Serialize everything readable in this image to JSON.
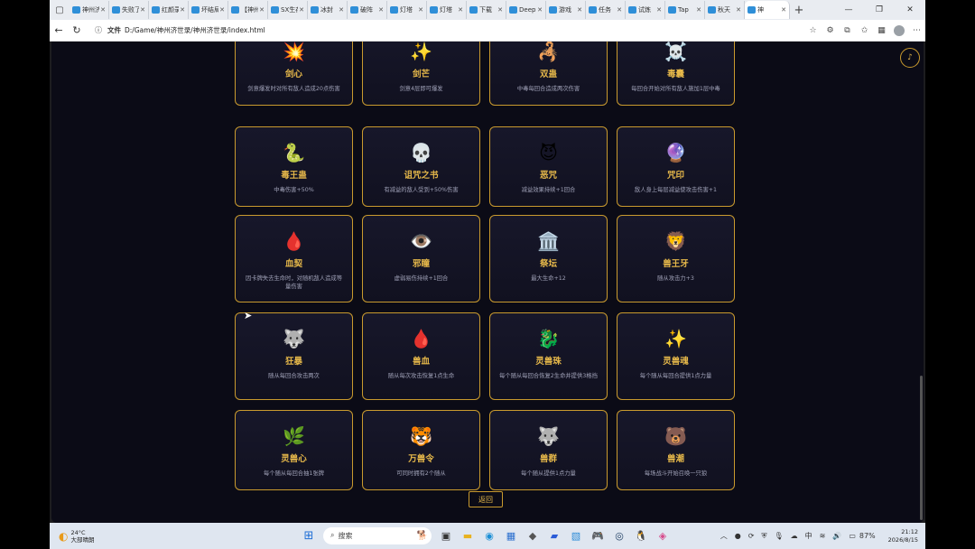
{
  "browser": {
    "tabs": [
      {
        "title": "神州济世录",
        "active": false
      },
      {
        "title": "失败了",
        "active": false
      },
      {
        "title": "红颜录",
        "active": false
      },
      {
        "title": "坏结局",
        "active": false
      },
      {
        "title": "【神州",
        "active": false
      },
      {
        "title": "SX生存",
        "active": false
      },
      {
        "title": "冰封",
        "active": false
      },
      {
        "title": "破阵",
        "active": false
      },
      {
        "title": "灯塔",
        "active": false
      },
      {
        "title": "灯塔",
        "active": false
      },
      {
        "title": "下载",
        "active": false
      },
      {
        "title": "Deep",
        "active": false
      },
      {
        "title": "游戏",
        "active": false
      },
      {
        "title": "任务",
        "active": false
      },
      {
        "title": "试炼",
        "active": false
      },
      {
        "title": "Tap",
        "active": false
      },
      {
        "title": "秋天",
        "active": false
      },
      {
        "title": "神",
        "active": true
      }
    ],
    "url_label": "文件",
    "url": "D:/Game/神州济世录/神州济世录/index.html"
  },
  "cards": [
    {
      "icon": "💥",
      "name": "剑心",
      "desc": "剑意爆发时对所有敌人造成20点伤害"
    },
    {
      "icon": "✨",
      "name": "剑芒",
      "desc": "剑意4层即可爆发"
    },
    {
      "icon": "🦂",
      "name": "双蛊",
      "desc": "中毒每回合造成两次伤害"
    },
    {
      "icon": "☠️",
      "name": "毒囊",
      "desc": "每回合开始对所有敌人施加1层中毒"
    },
    {
      "icon": "🐍",
      "name": "毒王蛊",
      "desc": "中毒伤害+50%"
    },
    {
      "icon": "💀",
      "name": "诅咒之书",
      "desc": "有减益的敌人受到+50%伤害"
    },
    {
      "icon": "😈",
      "name": "恶咒",
      "desc": "减益效果持续+1回合"
    },
    {
      "icon": "🔮",
      "name": "咒印",
      "desc": "敌人身上每层减益使攻击伤害+1"
    },
    {
      "icon": "🩸",
      "name": "血契",
      "desc": "因卡牌失去生命时，对随机敌人造成等量伤害"
    },
    {
      "icon": "👁️",
      "name": "邪瞳",
      "desc": "虚弱易伤持续+1回合"
    },
    {
      "icon": "🏛️",
      "name": "祭坛",
      "desc": "最大生命+12"
    },
    {
      "icon": "🦁",
      "name": "兽王牙",
      "desc": "随从攻击力+3"
    },
    {
      "icon": "🐺",
      "name": "狂暴",
      "desc": "随从每回合攻击两次"
    },
    {
      "icon": "🩸",
      "name": "兽血",
      "desc": "随从每次攻击恢复1点生命"
    },
    {
      "icon": "🐉",
      "name": "灵兽珠",
      "desc": "每个随从每回合恢复2生命并提供3格挡"
    },
    {
      "icon": "✨",
      "name": "灵兽魂",
      "desc": "每个随从每回合提供1点力量"
    },
    {
      "icon": "🌿",
      "name": "灵兽心",
      "desc": "每个随从每回合抽1张牌"
    },
    {
      "icon": "🐯",
      "name": "万兽令",
      "desc": "可同时拥有2个随从"
    },
    {
      "icon": "🐺",
      "name": "兽群",
      "desc": "每个随从提供1点力量"
    },
    {
      "icon": "🐻",
      "name": "兽潮",
      "desc": "每场战斗开始召唤一只狼"
    }
  ],
  "back_label": "返回",
  "music_icon": "♪",
  "taskbar": {
    "temp": "24°C",
    "weather": "大部晴朗",
    "search_placeholder": "搜索",
    "battery": "87%",
    "time": "21:12",
    "date": "2026/8/15"
  }
}
